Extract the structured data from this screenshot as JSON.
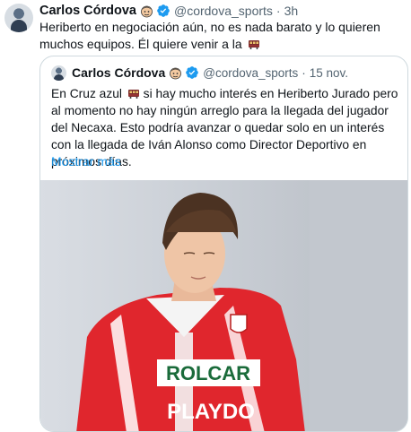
{
  "author": {
    "name": "Carlos Córdova",
    "handle": "@cordova_sports",
    "time": "3h",
    "separator": "·"
  },
  "tweet_text": "Heriberto en negociación aún, no es nada barato y lo quieren muchos equipos. Él quiere venir a la",
  "quoted": {
    "name": "Carlos Córdova",
    "handle": "@cordova_sports",
    "time": "15 nov.",
    "separator": "·",
    "text_part1": "En Cruz azul",
    "text_part2": "si hay mucho interés en Heriberto Jurado pero al momento no hay ningún arreglo para la llegada del jugador del Necaxa. Esto podría avanzar o quedar solo en un interés con la llegada de Iván Alonso como Director Deportivo en próximos días.",
    "ellipsis": "...",
    "show_more": "Mostrar más",
    "jersey_sponsor": "ROLCAR",
    "jersey_sponsor2": "PLAYDO"
  },
  "colors": {
    "verified": "#1d9bf0",
    "link": "#1d9bf0",
    "secondary_text": "#536471",
    "jersey_red": "#e0262d"
  },
  "icons": [
    "avatar",
    "face-emoji-icon",
    "verified-badge-icon",
    "train-emoji-icon"
  ]
}
